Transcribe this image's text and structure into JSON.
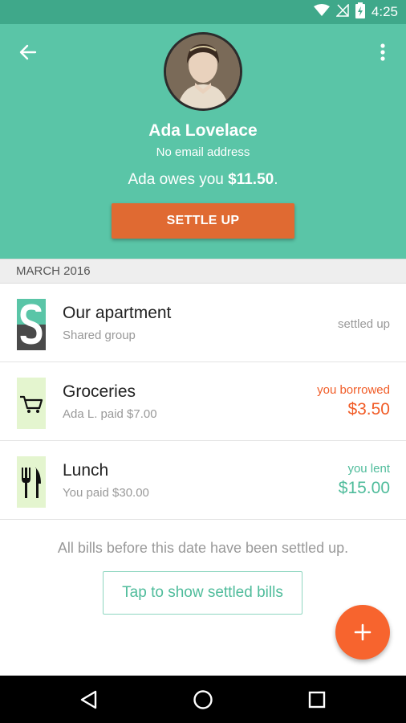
{
  "status_bar": {
    "time": "4:25",
    "icons": [
      "wifi-icon",
      "no-signal-icon",
      "battery-charging-icon"
    ]
  },
  "header": {
    "back_icon": "arrow-left-icon",
    "menu_icon": "more-vert-icon",
    "name": "Ada Lovelace",
    "email": "No email address",
    "owes_prefix": "Ada owes you ",
    "owes_amount": "$11.50",
    "owes_suffix": ".",
    "settle_button": "SETTLE UP",
    "colors": {
      "header_bg": "#5ac5a7",
      "status_bg": "#3fa88a",
      "settle_bg": "#e06a32"
    }
  },
  "month_header": "MARCH 2016",
  "items": [
    {
      "title": "Our apartment",
      "subtitle": "Shared group",
      "status": "settled up",
      "icon": "group-logo-icon"
    },
    {
      "title": "Groceries",
      "subtitle": "Ada L. paid $7.00",
      "label": "you borrowed",
      "amount": "$3.50",
      "tone": "orange",
      "icon": "cart-icon"
    },
    {
      "title": "Lunch",
      "subtitle": "You paid $30.00",
      "label": "you lent",
      "amount": "$15.00",
      "tone": "green",
      "icon": "fork-knife-icon"
    }
  ],
  "settled_note": "All bills before this date have been settled up.",
  "show_settled_button": "Tap to show settled bills",
  "fab_icon": "plus-icon",
  "nav": {
    "back": "nav-back-icon",
    "home": "nav-home-icon",
    "recents": "nav-recents-icon"
  },
  "accent_colors": {
    "orange": "#f15d28",
    "green": "#4fbc9b"
  }
}
